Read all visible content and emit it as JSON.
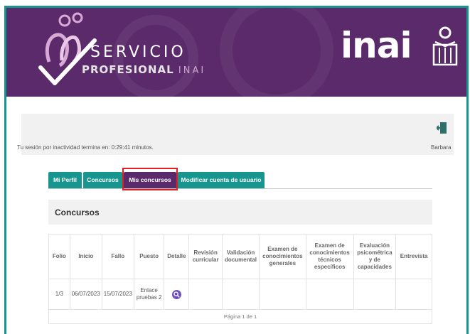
{
  "header": {
    "logo_line1": "SERVICIO",
    "logo_line2_bold": "PROFESIONAL",
    "logo_line2_light": "INAI",
    "brand": "inai",
    "colors": {
      "banner": "#5b2a6b",
      "frame": "#17958f",
      "tab": "#17958f",
      "tab_active": "#5b2a6b",
      "highlight": "#e02020"
    }
  },
  "session": {
    "text": "Tu sesión por inactividad termina en: 0:29:41 minutos.",
    "user": "Barbara",
    "logout_icon": "logout-door-icon"
  },
  "tabs": [
    {
      "label": "Mi Perfil",
      "active": false
    },
    {
      "label": "Concursos",
      "active": false
    },
    {
      "label": "Mis concursos",
      "active": true
    },
    {
      "label": "Modificar cuenta de usuario",
      "active": false
    }
  ],
  "section": {
    "title": "Concursos"
  },
  "table": {
    "headers": [
      "Folio",
      "Inicio",
      "Fallo",
      "Puesto",
      "Detalle",
      "Revisión curricular",
      "Validación documental",
      "Examen de conocimientos generales",
      "Examen de conocimientos técnicos específicos",
      "Evaluación psicométrica y de capacidades",
      "Entrevista"
    ],
    "rows": [
      {
        "folio": "1/3",
        "inicio": "06/07/2023",
        "fallo": "15/07/2023",
        "puesto": "Enlace pruebas 2",
        "detalle_icon": "search-icon",
        "revision": "",
        "validacion": "",
        "examen_gen": "",
        "examen_tec": "",
        "evaluacion": "",
        "entrevista": ""
      }
    ],
    "pagination": "Página 1 de 1"
  }
}
